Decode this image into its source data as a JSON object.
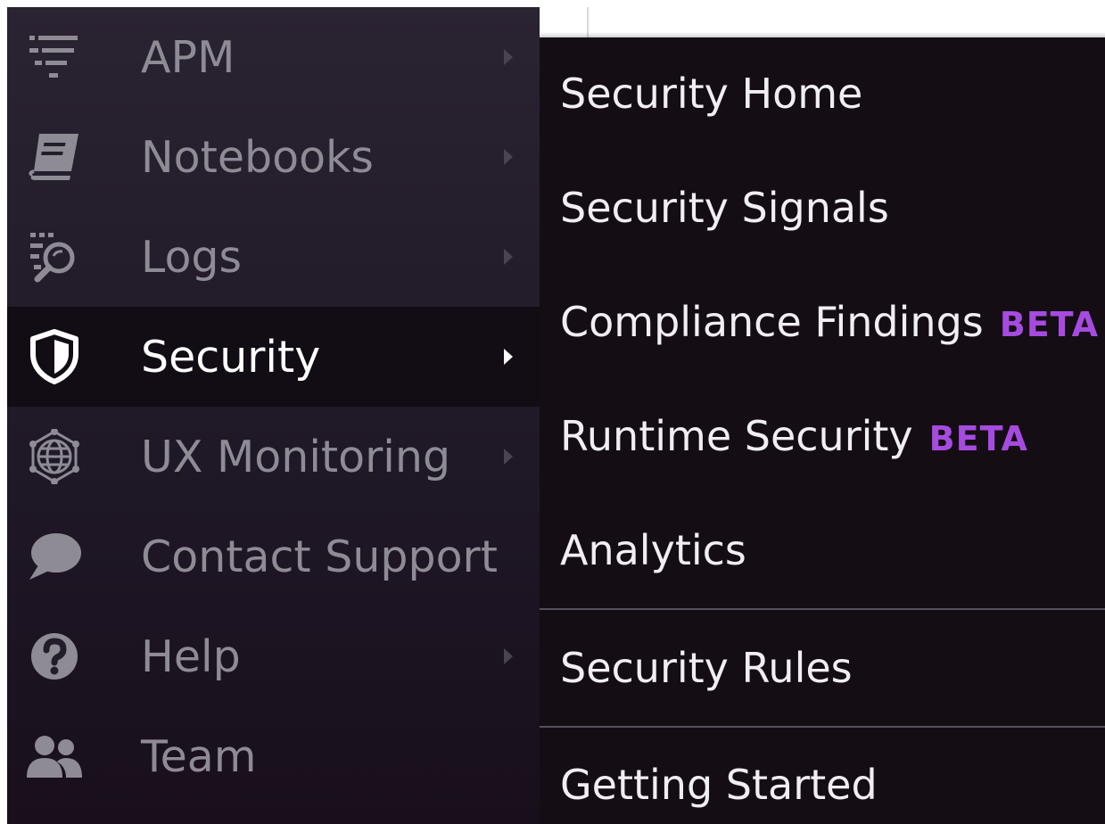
{
  "sidebar": {
    "items": [
      {
        "label": "APM",
        "icon": "apm-filter-icon",
        "has_submenu": true
      },
      {
        "label": "Notebooks",
        "icon": "notebook-icon",
        "has_submenu": true
      },
      {
        "label": "Logs",
        "icon": "logs-search-icon",
        "has_submenu": true
      },
      {
        "label": "Security",
        "icon": "shield-icon",
        "has_submenu": true,
        "active": true
      },
      {
        "label": "UX Monitoring",
        "icon": "globe-icon",
        "has_submenu": true
      },
      {
        "label": "Contact Support",
        "icon": "chat-bubble-icon",
        "has_submenu": false
      },
      {
        "label": "Help",
        "icon": "help-circle-icon",
        "has_submenu": true
      },
      {
        "label": "Team",
        "icon": "team-icon",
        "has_submenu": false
      }
    ]
  },
  "submenu": {
    "items": [
      {
        "label": "Security Home"
      },
      {
        "label": "Security Signals"
      },
      {
        "label": "Compliance Findings",
        "badge": "BETA"
      },
      {
        "label": "Runtime Security",
        "badge": "BETA"
      },
      {
        "label": "Analytics"
      },
      {
        "label": "Security Rules"
      },
      {
        "label": "Getting Started"
      }
    ]
  },
  "colors": {
    "sidebar_bg": "#231c2a",
    "active_bg": "#120c14",
    "submenu_bg": "#140d14",
    "inactive_text": "#8f8b95",
    "active_text": "#ffffff",
    "beta_badge": "#a64be0"
  }
}
